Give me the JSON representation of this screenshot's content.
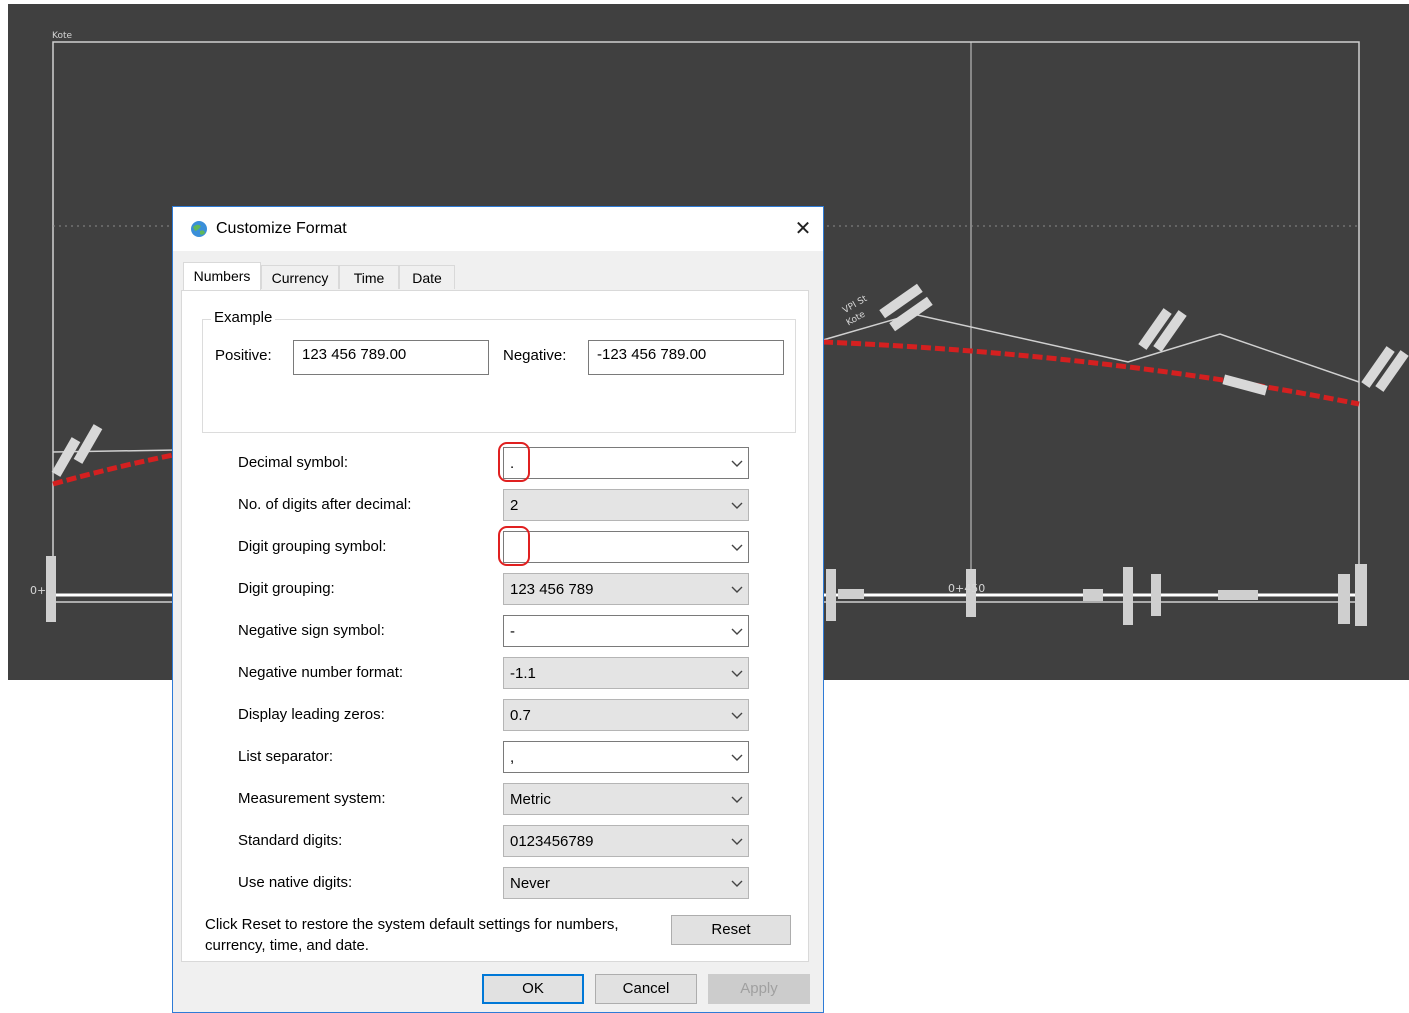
{
  "viewport": {
    "axis_label": "Kote",
    "station_label": "0+450",
    "left_station_label": "0+",
    "vpi_label": "VPI St",
    "kote_label": "Kote"
  },
  "dialog": {
    "title": "Customize Format",
    "close_glyph": "✕",
    "tabs": [
      "Numbers",
      "Currency",
      "Time",
      "Date"
    ],
    "active_tab": "Numbers",
    "example": {
      "legend": "Example",
      "positive_label": "Positive:",
      "positive_value": "123 456 789.00",
      "negative_label": "Negative:",
      "negative_value": "-123 456 789.00"
    },
    "settings": [
      {
        "label": "Decimal symbol:",
        "value": ".",
        "editable": true,
        "highlighted": true
      },
      {
        "label": "No. of digits after decimal:",
        "value": "2",
        "editable": false,
        "highlighted": false
      },
      {
        "label": "Digit grouping symbol:",
        "value": "",
        "editable": true,
        "highlighted": true
      },
      {
        "label": "Digit grouping:",
        "value": "123 456 789",
        "editable": false,
        "highlighted": false
      },
      {
        "label": "Negative sign symbol:",
        "value": "-",
        "editable": true,
        "highlighted": false
      },
      {
        "label": "Negative number format:",
        "value": "-1.1",
        "editable": false,
        "highlighted": false
      },
      {
        "label": "Display leading zeros:",
        "value": "0.7",
        "editable": false,
        "highlighted": false
      },
      {
        "label": "List separator:",
        "value": ",",
        "editable": true,
        "highlighted": false
      },
      {
        "label": "Measurement system:",
        "value": "Metric",
        "editable": false,
        "highlighted": false
      },
      {
        "label": "Standard digits:",
        "value": "0123456789",
        "editable": false,
        "highlighted": false
      },
      {
        "label": "Use native digits:",
        "value": "Never",
        "editable": false,
        "highlighted": false
      }
    ],
    "reset_note": "Click Reset to restore the system default settings for numbers, currency, time, and date.",
    "buttons": {
      "reset": "Reset",
      "ok": "OK",
      "cancel": "Cancel",
      "apply": "Apply"
    }
  },
  "colors": {
    "viewport_bg": "#404040",
    "profile_red": "#d42020",
    "highlight_red": "#e02020",
    "accent_blue": "#0078d7"
  }
}
